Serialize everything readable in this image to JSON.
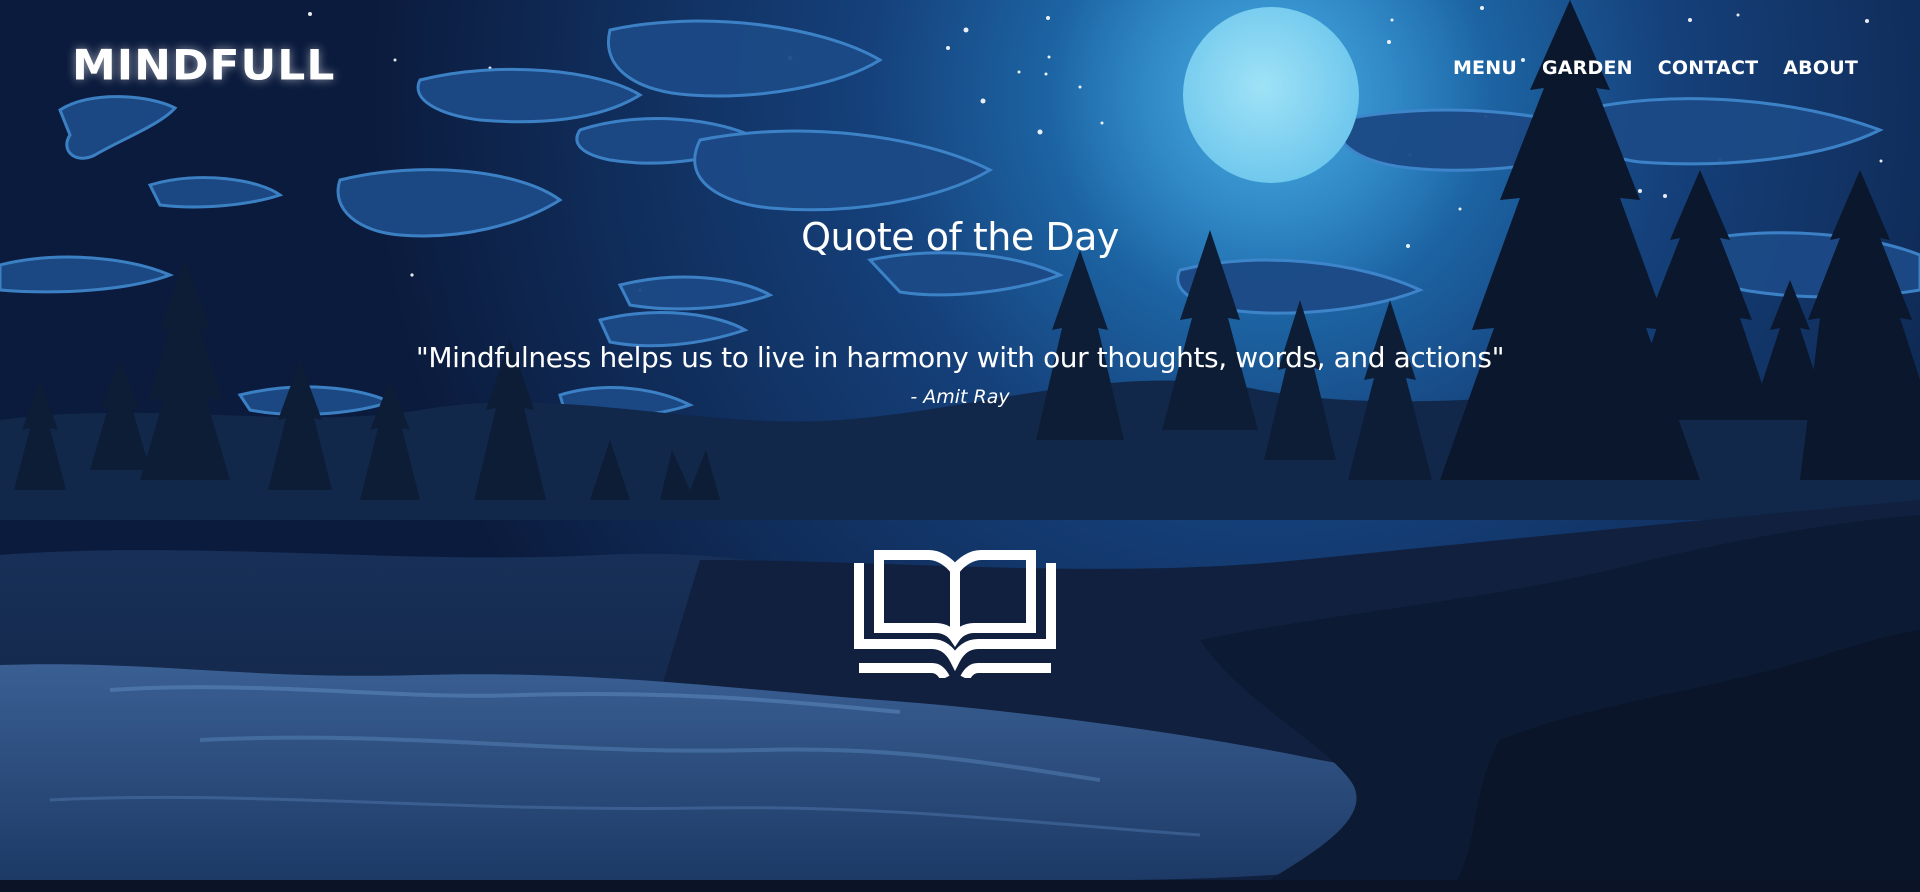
{
  "header": {
    "logo": "MINDFULL",
    "nav": [
      {
        "label": "MENU"
      },
      {
        "label": "GARDEN"
      },
      {
        "label": "CONTACT"
      },
      {
        "label": "ABOUT"
      }
    ]
  },
  "main": {
    "title": "Quote of the Day",
    "quote": "\"Mindfulness helps us to live in harmony with our thoughts, words, and actions\"",
    "author": "- Amit Ray",
    "book_icon": "open-book-icon"
  },
  "colors": {
    "sky_top": "#0c2a5a",
    "sky_mid": "#1a4f8a",
    "moon": "#86d3f0",
    "trees": "#0a1526",
    "text": "#ffffff"
  }
}
